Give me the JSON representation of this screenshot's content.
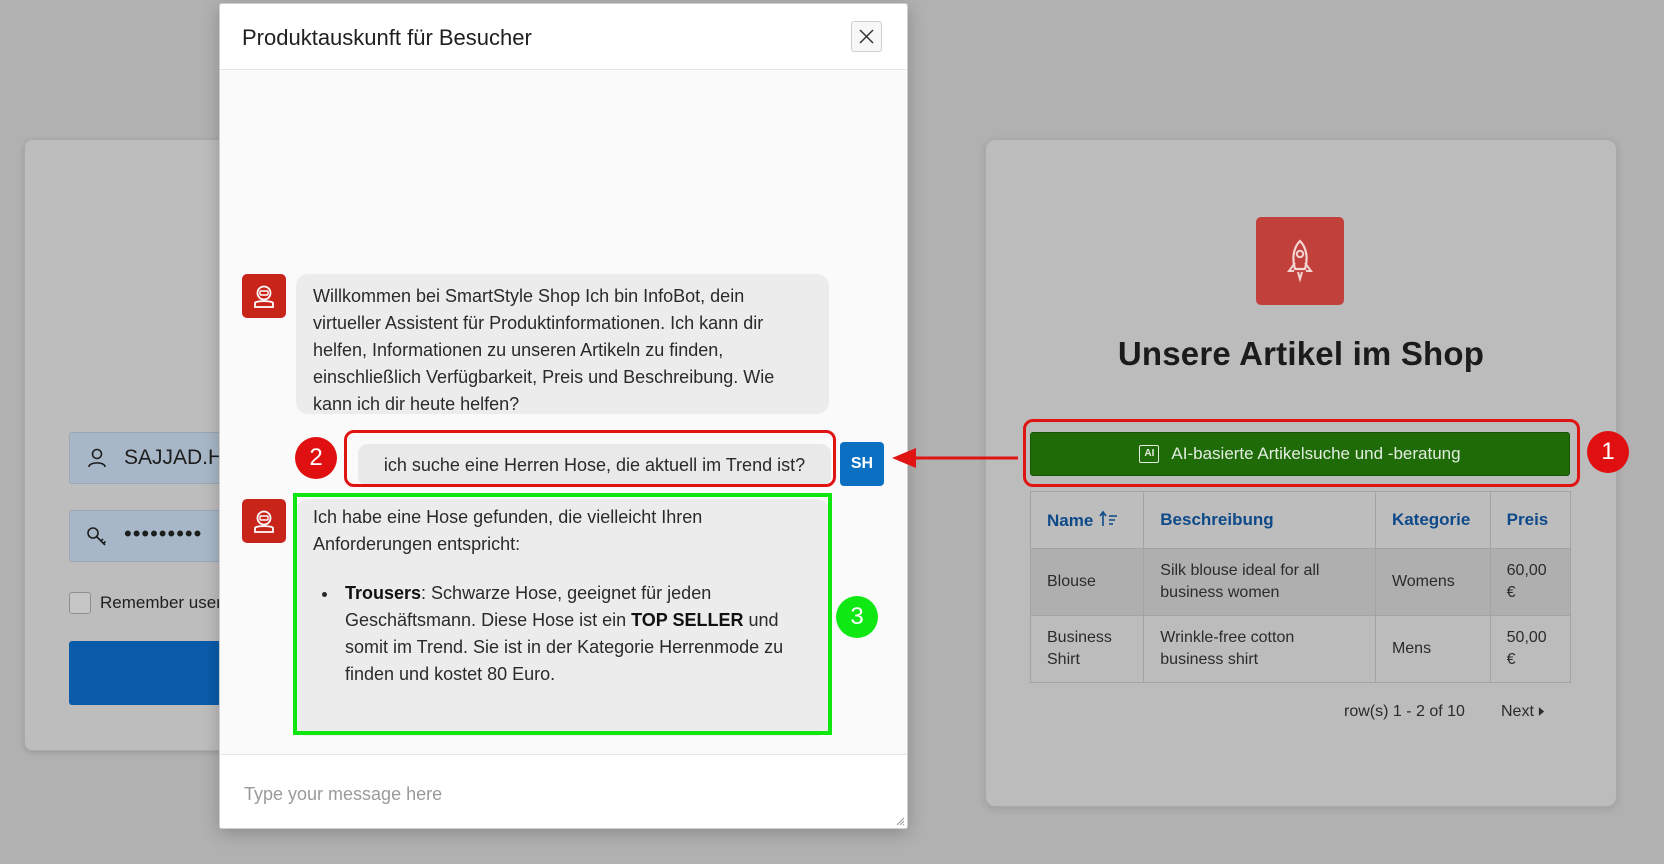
{
  "login": {
    "username_value": "SAJJAD.H",
    "password_value": "•••••••••",
    "remember_label": "Remember username"
  },
  "products": {
    "title": "Unsere Artikel im Shop",
    "ai_button_icon": "AI",
    "ai_button_label": "AI-basierte Artikelsuche und -beratung",
    "columns": [
      "Name",
      "Beschreibung",
      "Kategorie",
      "Preis"
    ],
    "rows": [
      {
        "name": "Blouse",
        "description": "Silk blouse ideal for all business women",
        "category": "Womens",
        "price": "60,00 €"
      },
      {
        "name": "Business Shirt",
        "description": "Wrinkle-free cotton business shirt",
        "category": "Mens",
        "price": "50,00 €"
      }
    ],
    "pagination_info": "row(s) 1 - 2 of 10",
    "next_label": "Next"
  },
  "dialog": {
    "title": "Produktauskunft für Besucher",
    "messages": {
      "bot_welcome": "Willkommen bei SmartStyle Shop Ich bin InfoBot, dein virtueller Assistent für Produktinformationen. Ich kann dir helfen, Informationen zu unseren Artikeln zu finden, einschließlich Verfügbarkeit, Preis und Beschreibung. Wie kann ich dir heute helfen?",
      "user_question": "ich suche eine Herren Hose, die aktuell im Trend ist?",
      "user_initials": "SH",
      "bot_reply_intro": "Ich habe eine Hose gefunden, die vielleicht Ihren Anforderungen entspricht:",
      "bot_reply_item_name": "Trousers",
      "bot_reply_item_text_1": ": Schwarze Hose, geeignet für jeden Geschäftsmann. Diese Hose ist ein ",
      "bot_reply_item_highlight": "TOP SELLER",
      "bot_reply_item_text_2": " und somit im Trend. Sie ist in der Kategorie Herrenmode zu finden und kostet 80 Euro."
    },
    "input_placeholder": "Type your message here"
  },
  "annotations": {
    "badge_1": "1",
    "badge_2": "2",
    "badge_3": "3",
    "highlight_red": "#e11414",
    "highlight_green": "#0de60f"
  },
  "colors": {
    "ai_button": "#1e6b07",
    "user_avatar": "#0b6fc2",
    "bot_avatar": "#c8241a",
    "logo": "#c2403b",
    "table_header_text": "#0e4a8a"
  }
}
